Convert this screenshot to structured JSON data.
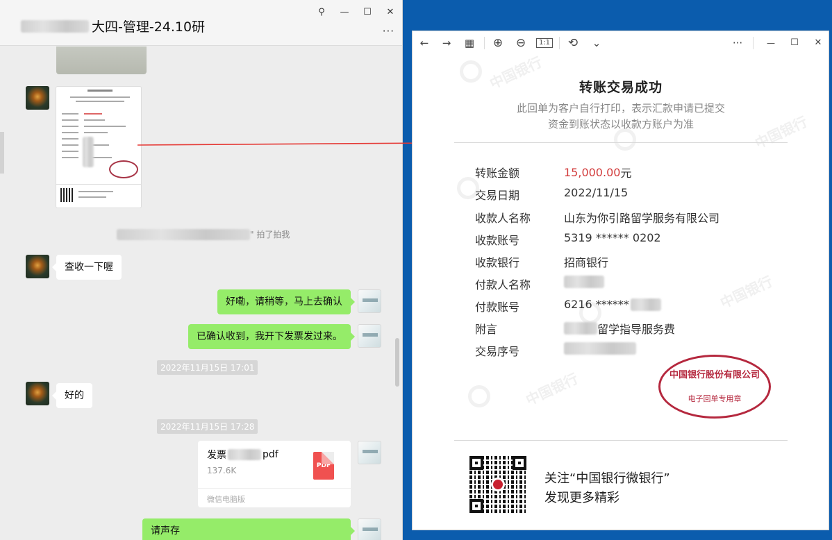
{
  "chat": {
    "title": "大四-管理-24.10研",
    "more": "···",
    "pin_icon": "pin-icon",
    "system_note_suffix": "\" 拍了拍我",
    "messages": [
      {
        "side": "left",
        "text": "查收一下喔"
      },
      {
        "side": "right",
        "text": "好嘞，请稍等，马上去确认"
      },
      {
        "side": "right",
        "text": "已确认收到，我开下发票发过来。"
      },
      {
        "side": "left",
        "text": "好的"
      },
      {
        "side": "right",
        "text": "请声存"
      }
    ],
    "timestamps": [
      "2022年11月15日 17:01",
      "2022年11月15日 17:28"
    ],
    "file": {
      "name_prefix": "发票",
      "name_suffix": "pdf",
      "size": "137.6K",
      "source": "微信电脑版",
      "type_label": "PDF"
    }
  },
  "viewer": {
    "toolbar": {
      "back": "←",
      "forward": "→",
      "grid": "▦",
      "zoom_in": "⊕",
      "zoom_out": "⊖",
      "actual_size": "1:1",
      "rotate": "⟲",
      "dropdown": "⌄",
      "more": "···",
      "minimize": "—",
      "maximize": "☐",
      "close": "✕"
    },
    "receipt": {
      "title": "转账交易成功",
      "subtitle_1": "此回单为客户自行打印，表示汇款申请已提交",
      "subtitle_2": "资金到账状态以收款方账户为准",
      "rows": [
        {
          "label": "转账金额",
          "value": "15,000.00",
          "unit": " 元"
        },
        {
          "label": "交易日期",
          "value": "2022/11/15"
        },
        {
          "label": "收款人名称",
          "value": "山东为你引路留学服务有限公司"
        },
        {
          "label": "收款账号",
          "value": "5319 ****** 0202"
        },
        {
          "label": "收款银行",
          "value": "招商银行"
        },
        {
          "label": "付款人名称",
          "value": ""
        },
        {
          "label": "付款账号",
          "value": "6216 ******"
        },
        {
          "label": "附言",
          "value": "留学指导服务费"
        },
        {
          "label": "交易序号",
          "value": ""
        }
      ],
      "stamp_top": "中国银行股份有限公司",
      "stamp_bottom": "电子回单专用章",
      "follow_1": "关注“中国银行微银行”",
      "follow_2": "发现更多精彩"
    }
  },
  "colors": {
    "desktop": "#0b5cad",
    "chat_bubble_self": "#95ec69",
    "amount": "#d23b3b",
    "stamp": "#b5283e",
    "arrow": "#e53935"
  }
}
